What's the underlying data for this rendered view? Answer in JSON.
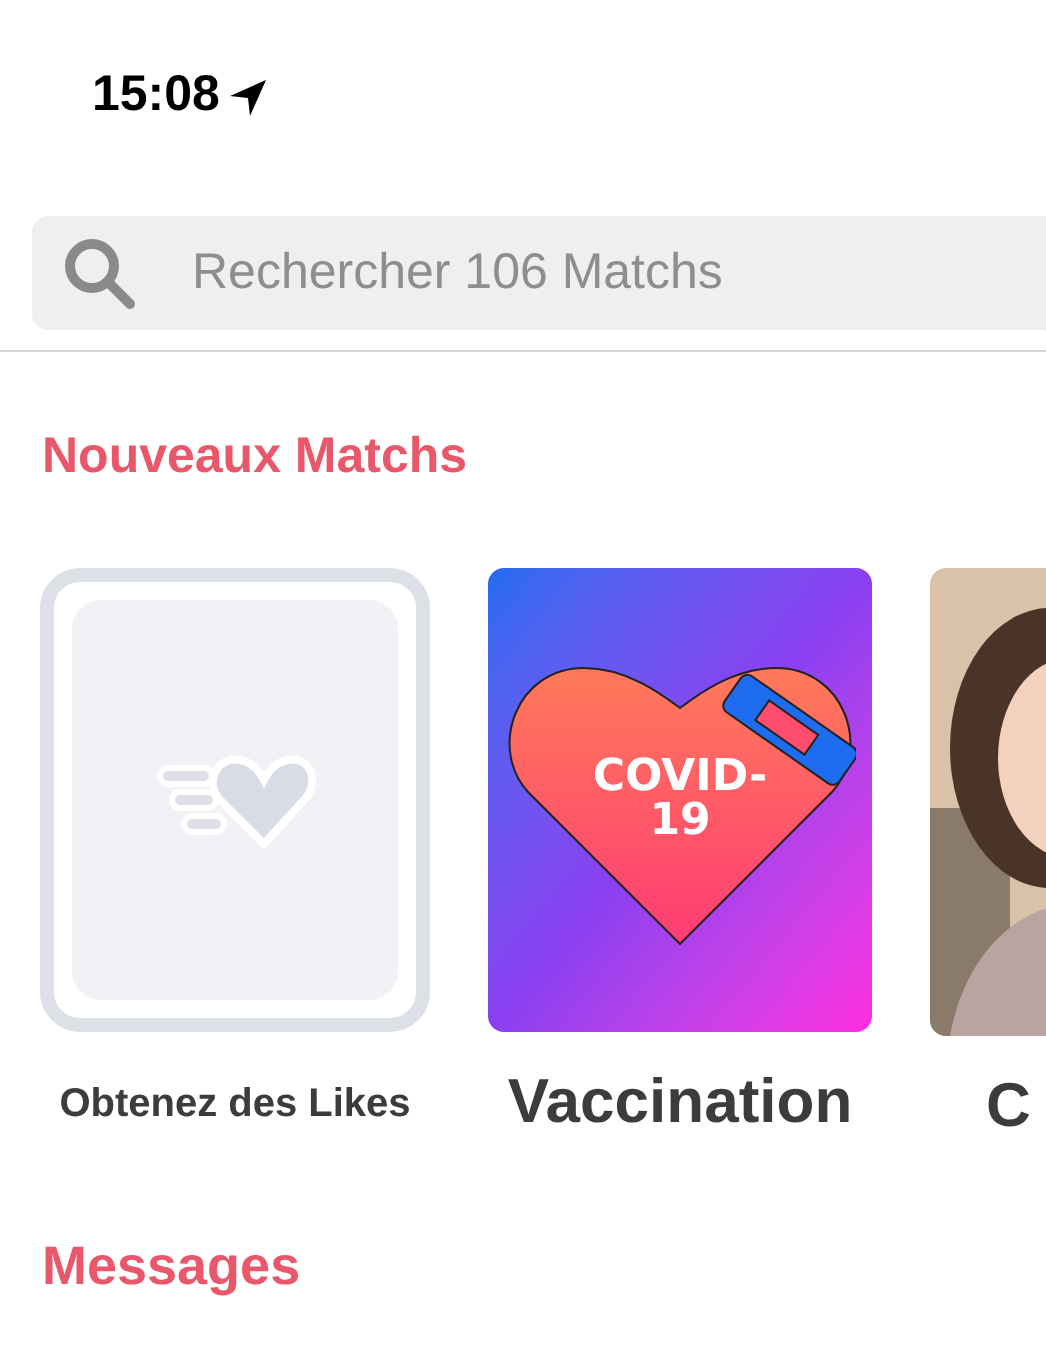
{
  "status_bar": {
    "time": "15:08"
  },
  "search": {
    "placeholder": "Rechercher 106 Matchs"
  },
  "new_matches": {
    "title": "Nouveaux Matchs",
    "cards": [
      {
        "kind": "likes",
        "label": "Obtenez des Likes"
      },
      {
        "kind": "artwork",
        "label": "Vaccination",
        "artwork_lines": [
          "COVID-",
          "19"
        ]
      },
      {
        "label": "C"
      }
    ]
  },
  "messages": {
    "title": "Messages"
  }
}
